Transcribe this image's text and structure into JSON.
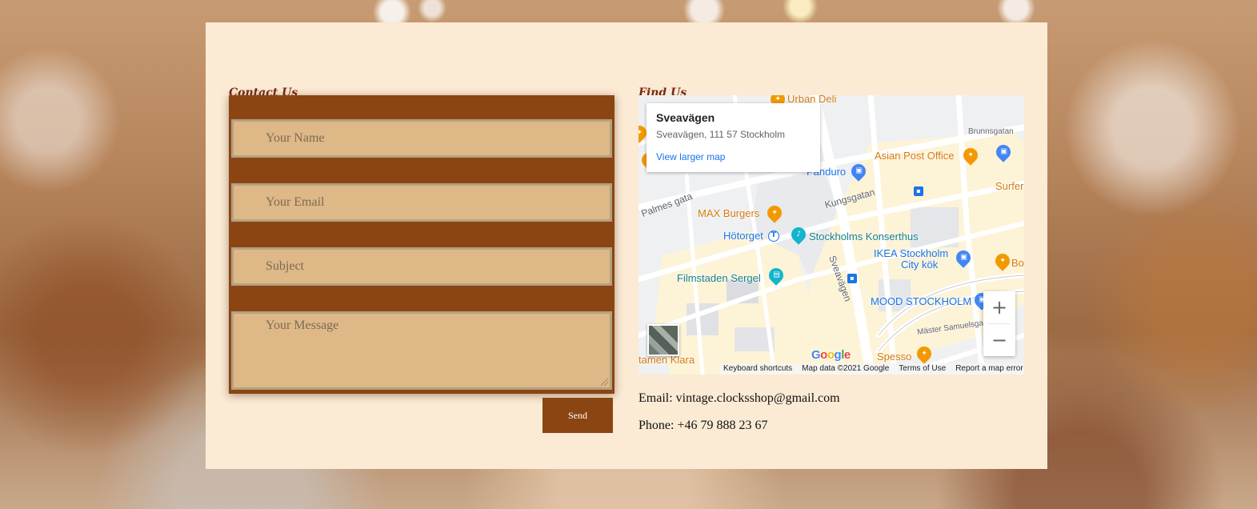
{
  "contact": {
    "title": "Contact Us",
    "name_placeholder": "Your Name",
    "email_placeholder": "Your Email",
    "subject_placeholder": "Subject",
    "message_placeholder": "Your Message",
    "send_label": "Send"
  },
  "find": {
    "title": "Find Us",
    "map": {
      "place_title": "Sveavägen",
      "place_address": "Sveavägen, 111 57 Stockholm",
      "view_larger": "View larger map",
      "zoom_in": "+",
      "zoom_out": "−",
      "attribution": {
        "shortcuts": "Keyboard shortcuts",
        "data": "Map data ©2021 Google",
        "terms": "Terms of Use",
        "report": "Report a map error"
      },
      "pois": {
        "urban_deli": "Urban Deli",
        "asian_post": "Asian Post Office",
        "panduro": "Panduro",
        "surfers": "Surfers",
        "max": "MAX Burgers",
        "hotorget": "Hötorget",
        "konserthus": "Stockholms Konserthus",
        "ikea_1": "IKEA Stockholm",
        "ikea_2": "City kök",
        "bo": "Bo",
        "filmstaden": "Filmstaden Sergel",
        "mood": "MOOD STOCKHOLM",
        "spesso": "Spesso",
        "klara": "tamen Klara"
      },
      "streets": {
        "kungsgatan": "Kungsgatan",
        "palmes": "Palmes gata",
        "sveavagen": "Sveavägen",
        "brunnsgatan": "Brunnsgatan",
        "samuelsgatan": "Mäster Samuelsgat"
      },
      "logo": "Google"
    },
    "email_text": "Email: vintage.clocksshop@gmail.com",
    "phone_text": "Phone: +46 79 888 23 67"
  },
  "colors": {
    "panel": "#fbead4",
    "brown": "#8b4513",
    "field": "#deb887",
    "title": "#7a2a12"
  }
}
